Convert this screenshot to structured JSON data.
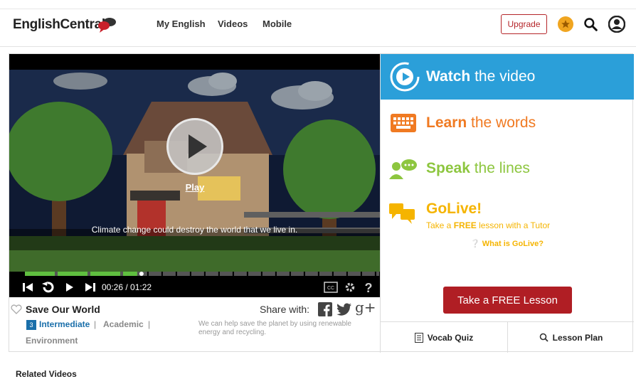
{
  "header": {
    "logo_bold": "EnglishCentral",
    "nav": [
      "My English",
      "Videos",
      "Mobile"
    ],
    "upgrade_label": "Upgrade",
    "icons": [
      "star-icon",
      "search-icon",
      "user-icon"
    ]
  },
  "player": {
    "subtitle": "Climate change could destroy the world that we live in.",
    "play_label": "Play",
    "timecode": "00:26 / 01:22",
    "progress_fraction": 0.317
  },
  "video": {
    "title": "Save Our World",
    "share_label": "Share with:",
    "level_number": "3",
    "level_label": "Intermediate",
    "tags": [
      "Academic",
      "Environment"
    ],
    "separator": "|",
    "description": "We can help save the planet by using renewable energy and recycling."
  },
  "steps": {
    "watch": {
      "bold": "Watch",
      "rest": "the video"
    },
    "learn": {
      "bold": "Learn",
      "rest": "the words"
    },
    "speak": {
      "bold": "Speak",
      "rest": "the lines"
    },
    "golive": {
      "title": "GoLive!",
      "sub_pre": "Take a",
      "sub_bold": "FREE",
      "sub_post": "lesson with a Tutor",
      "whatis": "What is GoLive?"
    }
  },
  "cta": {
    "free_lesson": "Take a FREE Lesson"
  },
  "tabs": {
    "vocab": "Vocab Quiz",
    "lesson": "Lesson Plan"
  },
  "related": {
    "heading": "Related Videos"
  },
  "colors": {
    "brand_red": "#b01e24",
    "watch_blue": "#2b9fd9",
    "learn_orange": "#f07a22",
    "speak_green": "#8dc63f",
    "golive_yellow": "#f5b400",
    "level_blue": "#1a6faa"
  }
}
